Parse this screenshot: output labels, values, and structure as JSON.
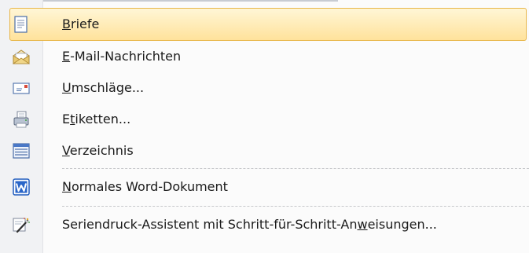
{
  "menu": {
    "items": [
      {
        "id": "briefe",
        "pre": "",
        "key": "B",
        "post": "riefe",
        "icon": "document-icon",
        "selected": true
      },
      {
        "id": "email",
        "pre": "",
        "key": "E",
        "post": "-Mail-Nachrichten",
        "icon": "envelope-open-icon"
      },
      {
        "id": "umschlaege",
        "pre": "",
        "key": "U",
        "post": "mschläge...",
        "icon": "envelope-icon"
      },
      {
        "id": "etiketten",
        "pre": "E",
        "key": "t",
        "post": "iketten...",
        "icon": "labels-printer-icon"
      },
      {
        "id": "verzeichnis",
        "pre": "",
        "key": "V",
        "post": "erzeichnis",
        "icon": "directory-list-icon"
      },
      {
        "id": "normal",
        "pre": "",
        "key": "N",
        "post": "ormales Word-Dokument",
        "icon": "word-document-icon"
      },
      {
        "id": "assistent",
        "pre": "Seriendruck-Assistent mit Schritt-für-Schritt-An",
        "key": "w",
        "post": "eisungen...",
        "icon": "wizard-wand-icon"
      }
    ]
  },
  "colors": {
    "hover_fill_top": "#fff6d6",
    "hover_fill_bottom": "#ffe29b",
    "hover_border": "#e8b74a",
    "separator": "#c6c7ca",
    "word_blue": "#1f5bbd"
  }
}
